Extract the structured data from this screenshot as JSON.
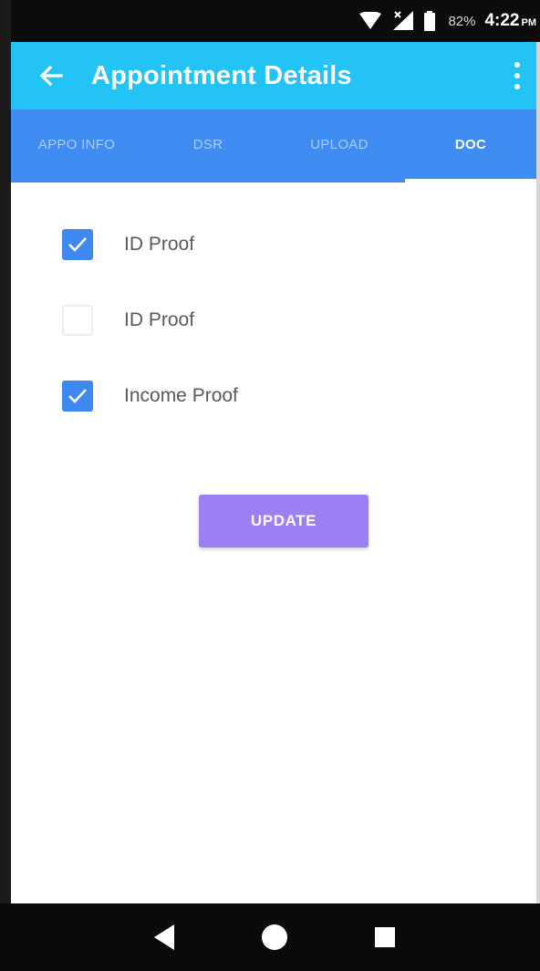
{
  "status_bar": {
    "battery": "82%",
    "time": "4:22",
    "ampm": "PM"
  },
  "app_bar": {
    "title": "Appointment Details"
  },
  "tabs": [
    {
      "label": "APPO INFO",
      "active": false
    },
    {
      "label": "DSR",
      "active": false
    },
    {
      "label": "UPLOAD",
      "active": false
    },
    {
      "label": "DOC",
      "active": true
    }
  ],
  "checklist": [
    {
      "label": "ID Proof",
      "checked": true
    },
    {
      "label": "ID Proof",
      "checked": false
    },
    {
      "label": "Income Proof",
      "checked": true
    }
  ],
  "update_button": {
    "label": "UPDATE"
  },
  "colors": {
    "app_bar": "#23c4f5",
    "tab_bar": "#3f8cf2",
    "checkbox_checked": "#3e88f0",
    "button": "#9b7ff3"
  }
}
